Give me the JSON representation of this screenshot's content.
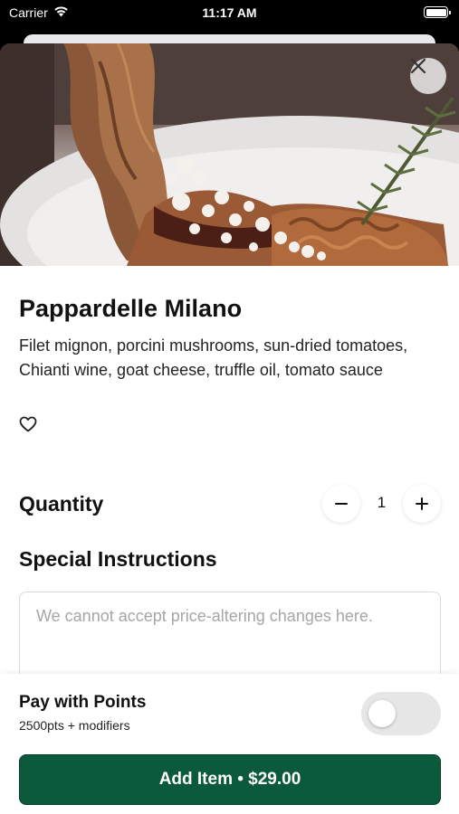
{
  "status_bar": {
    "carrier": "Carrier",
    "time": "11:17 AM"
  },
  "item": {
    "name": "Pappardelle Milano",
    "description": "Filet mignon, porcini mushrooms, sun-dried tomatoes, Chianti wine, goat cheese, truffle oil, tomato sauce"
  },
  "quantity": {
    "label": "Quantity",
    "value": "1"
  },
  "special_instructions": {
    "label": "Special Instructions",
    "placeholder": "We cannot accept price-altering changes here."
  },
  "points": {
    "title": "Pay with Points",
    "subtitle": "2500pts + modifiers",
    "enabled": false
  },
  "add_button": {
    "label": "Add Item • $29.00"
  },
  "colors": {
    "primary_button": "#0b5a3c"
  },
  "icons": [
    "wifi-icon",
    "battery-icon",
    "close-icon",
    "heart-icon",
    "minus-icon",
    "plus-icon"
  ]
}
